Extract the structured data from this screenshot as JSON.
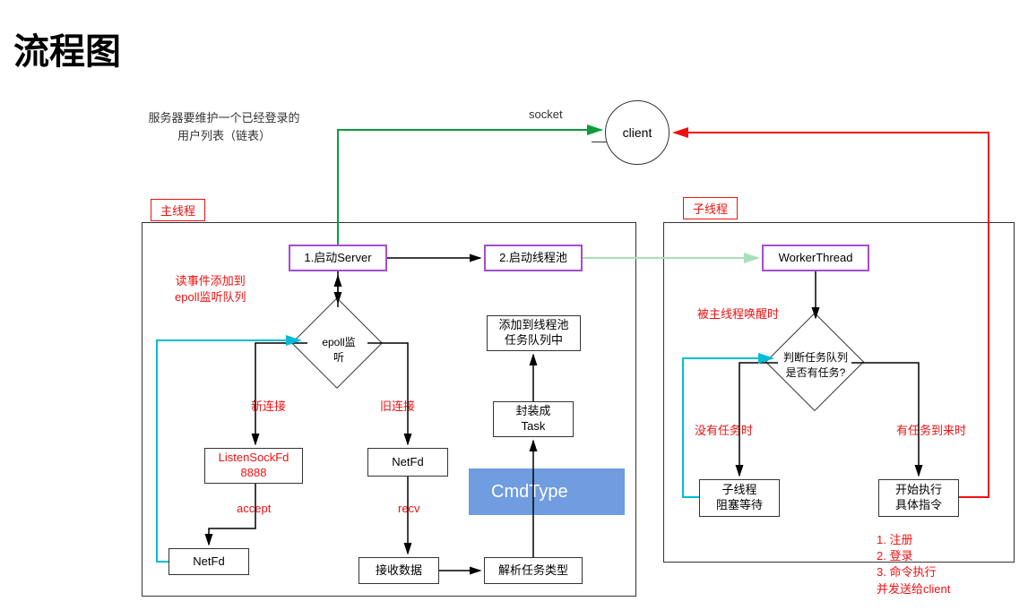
{
  "title": "流程图",
  "serverNote": "服务器要维护一个已经登录的\n用户列表（链表）",
  "socketLabel": "socket",
  "client": "client",
  "mainThreadTag": "主线程",
  "subThreadTag": "子线程",
  "startServer": "1.启动Server",
  "startPool": "2.启动线程池",
  "workerThread": "WorkerThread",
  "epollListen": "epoll监\n听",
  "readEventNote": "读事件添加到\nepoll监听队列",
  "newConn": "新连接",
  "oldConn": "旧连接",
  "listenSock": "ListenSockFd\n8888",
  "netFd1": "NetFd",
  "netFd2": "NetFd",
  "accept": "accept",
  "recv": "recv",
  "recvData": "接收数据",
  "parseTask": "解析任务类型",
  "cmdType": "CmdType",
  "packTask": "封装成\nTask",
  "addToPool": "添加到线程池\n任务队列中",
  "wakeNote": "被主线程唤醒时",
  "judgeQueue": "判断任务队列\n是否有任务?",
  "noTask": "没有任务时",
  "hasTask": "有任务到来时",
  "childWait": "子线程\n阻塞等待",
  "execCmd": "开始执行\n具体指令",
  "cmdList": "1. 注册\n2. 登录\n3. 命令执行\n并发送给client"
}
